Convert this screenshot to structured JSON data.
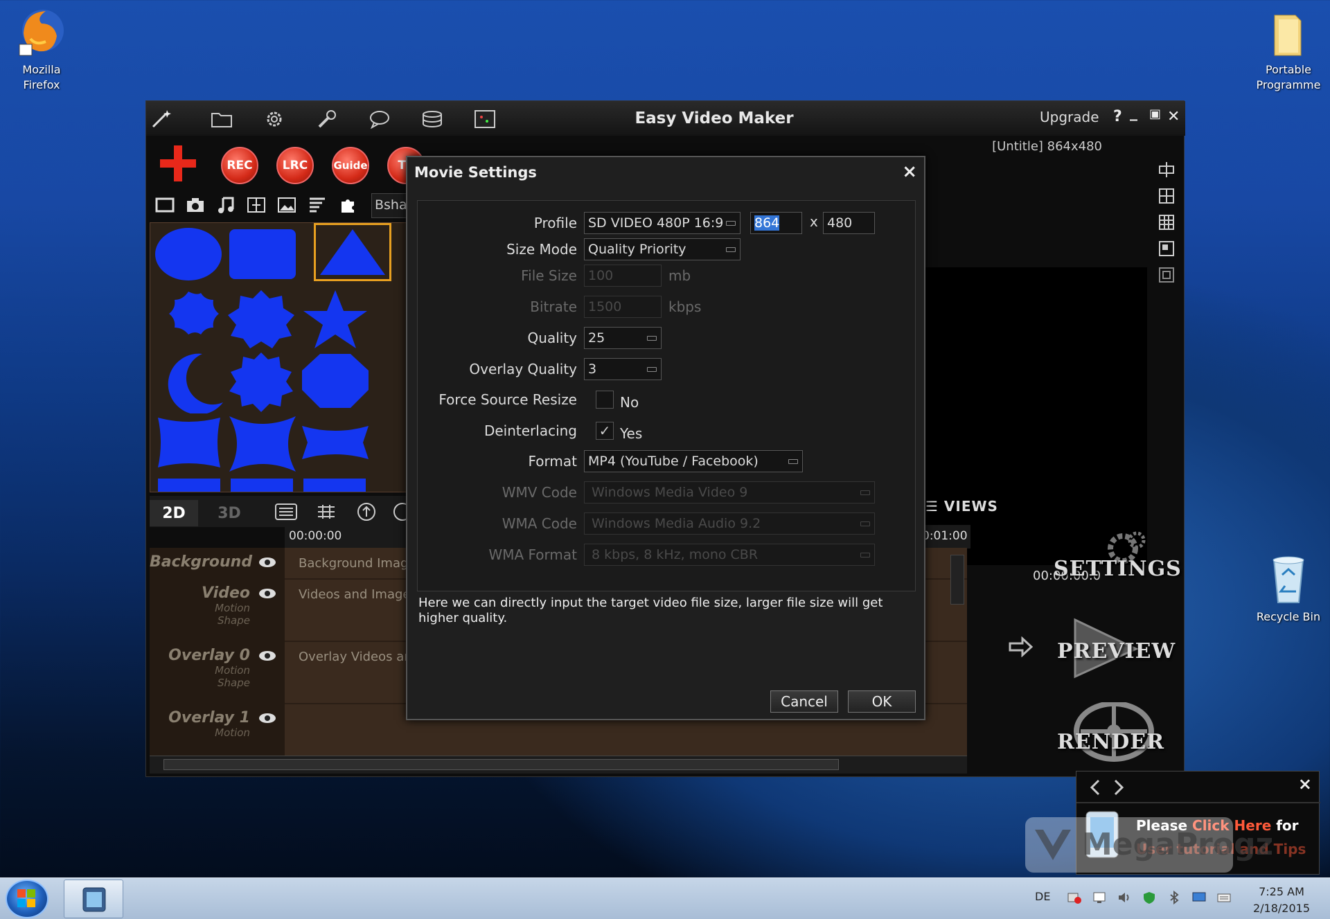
{
  "desktop": {
    "icons": [
      {
        "label_line1": "Mozilla",
        "label_line2": "Firefox",
        "icon": "firefox-icon"
      },
      {
        "label_line1": "Portable",
        "label_line2": "Programme",
        "icon": "folder-icon"
      },
      {
        "label_line1": "Recycle Bin",
        "label_line2": "",
        "icon": "recycle-bin-icon"
      }
    ]
  },
  "app": {
    "title": "Easy Video Maker",
    "upgrade": "Upgrade",
    "help": "?",
    "file_info": "[Untitle] 864x480",
    "toolbar_icons": [
      "magic-wand-icon",
      "folder-open-icon",
      "gear-icon",
      "wrench-icon",
      "chat-icon",
      "database-icon",
      "display-icon"
    ],
    "record_buttons": [
      "REC",
      "LRC",
      "Guide",
      "TE"
    ],
    "add_label": "+",
    "shape_filter": "Bshape",
    "tabs": {
      "tab_2d": "2D",
      "tab_3d": "3D"
    },
    "views_label": "VIEWS",
    "ruler": {
      "start": "00:00:00",
      "end": "0:01:00"
    },
    "timecode": "00:00:00.0",
    "tracks": [
      {
        "name": "Background",
        "sub1": "",
        "sub2": "",
        "caption": "Background Image"
      },
      {
        "name": "Video",
        "sub1": "Motion",
        "sub2": "Shape",
        "caption": "Videos and Image"
      },
      {
        "name": "Overlay 0",
        "sub1": "Motion",
        "sub2": "Shape",
        "caption": "Overlay Videos an"
      },
      {
        "name": "Overlay 1",
        "sub1": "Motion",
        "sub2": "",
        "caption": ""
      }
    ],
    "side_buttons": {
      "settings": "SETTINGS",
      "preview": "PREVIEW",
      "render": "RENDER"
    },
    "colors": {
      "shape_blue": "#1436f0",
      "accent_red": "#e8281a",
      "selected_border": "#e8a020"
    }
  },
  "dialog": {
    "title": "Movie Settings",
    "close": "×",
    "profile": {
      "label": "Profile",
      "value": "SD VIDEO 480P 16:9",
      "width": "864",
      "height": "480",
      "x": "x"
    },
    "size_mode": {
      "label": "Size Mode",
      "value": "Quality Priority"
    },
    "file_size": {
      "label": "File Size",
      "value": "100",
      "unit": "mb"
    },
    "bitrate": {
      "label": "Bitrate",
      "value": "1500",
      "unit": "kbps"
    },
    "quality": {
      "label": "Quality",
      "value": "25"
    },
    "overlay_quality": {
      "label": "Overlay Quality",
      "value": "3"
    },
    "force_resize": {
      "label": "Force Source Resize",
      "checked": false,
      "text": "No"
    },
    "deinterlacing": {
      "label": "Deinterlacing",
      "checked": true,
      "text": "Yes",
      "mark": "✓"
    },
    "format": {
      "label": "Format",
      "value": "MP4 (YouTube / Facebook)"
    },
    "wmv_code": {
      "label": "WMV Code",
      "value": "Windows Media Video 9"
    },
    "wma_code": {
      "label": "WMA Code",
      "value": "Windows Media Audio 9.2"
    },
    "wma_format": {
      "label": "WMA Format",
      "value": "8 kbps, 8 kHz, mono CBR"
    },
    "hint": "Here we can directly input the target video file size, larger file size will get higher quality.",
    "cancel": "Cancel",
    "ok": "OK"
  },
  "tips_popup": {
    "close": "×",
    "please": "Please ",
    "click_here": "Click Here",
    "for": " for",
    "line2": "User tutorial and Tips",
    "watermark": "MegaProgz"
  },
  "taskbar": {
    "lang": "DE",
    "time": "7:25 AM",
    "date": "2/18/2015"
  }
}
